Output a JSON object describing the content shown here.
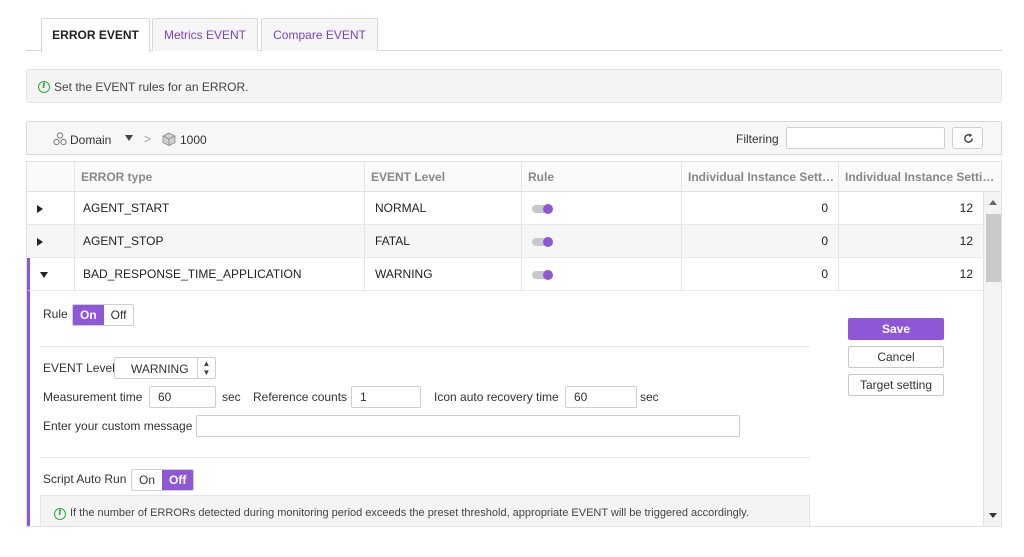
{
  "tabs": [
    {
      "label": "ERROR EVENT",
      "active": true
    },
    {
      "label": "Metrics EVENT",
      "active": false
    },
    {
      "label": "Compare EVENT",
      "active": false
    }
  ],
  "info": {
    "text": "Set the EVENT rules for an ERROR."
  },
  "toolbar": {
    "domain_label": "Domain",
    "node_label": "1000",
    "filter_label": "Filtering",
    "filter_value": ""
  },
  "grid": {
    "columns": [
      "",
      "ERROR type",
      "EVENT Level",
      "Rule",
      "Individual Instance Sett…",
      "Individual Instance Setti…"
    ],
    "rows": [
      {
        "error_type": "AGENT_START",
        "level": "NORMAL",
        "rule_on": true,
        "inst1": "0",
        "inst2": "12",
        "expanded": false
      },
      {
        "error_type": "AGENT_STOP",
        "level": "FATAL",
        "rule_on": true,
        "inst1": "0",
        "inst2": "12",
        "expanded": false
      },
      {
        "error_type": "BAD_RESPONSE_TIME_APPLICATION",
        "level": "WARNING",
        "rule_on": true,
        "inst1": "0",
        "inst2": "12",
        "expanded": true
      }
    ]
  },
  "detail": {
    "rule_label": "Rule",
    "rule_on": "On",
    "rule_off": "Off",
    "event_level_label": "EVENT Level",
    "event_level_value": "WARNING",
    "measurement_label": "Measurement time",
    "measurement_value": "60",
    "measurement_unit": "sec",
    "ref_counts_label": "Reference counts",
    "ref_counts_value": "1",
    "recovery_label": "Icon auto recovery time",
    "recovery_value": "60",
    "recovery_unit": "sec",
    "custom_msg_label": "Enter your custom message",
    "custom_msg_value": "",
    "script_label": "Script Auto Run",
    "script_on": "On",
    "script_off": "Off",
    "note": "If the number of ERRORs detected during monitoring period exceeds the preset threshold, appropriate EVENT will be triggered accordingly."
  },
  "actions": {
    "save": "Save",
    "cancel": "Cancel",
    "target": "Target setting"
  },
  "colors": {
    "accent": "#8e57d8",
    "info_green": "#2faa3c"
  },
  "icons": {
    "info": "info-icon",
    "domain": "domain-icon",
    "node": "cube-icon",
    "refresh": "refresh-icon",
    "expand": "triangle-right-icon",
    "collapse": "triangle-down-icon",
    "rule_toggle": "toggle-icon"
  }
}
